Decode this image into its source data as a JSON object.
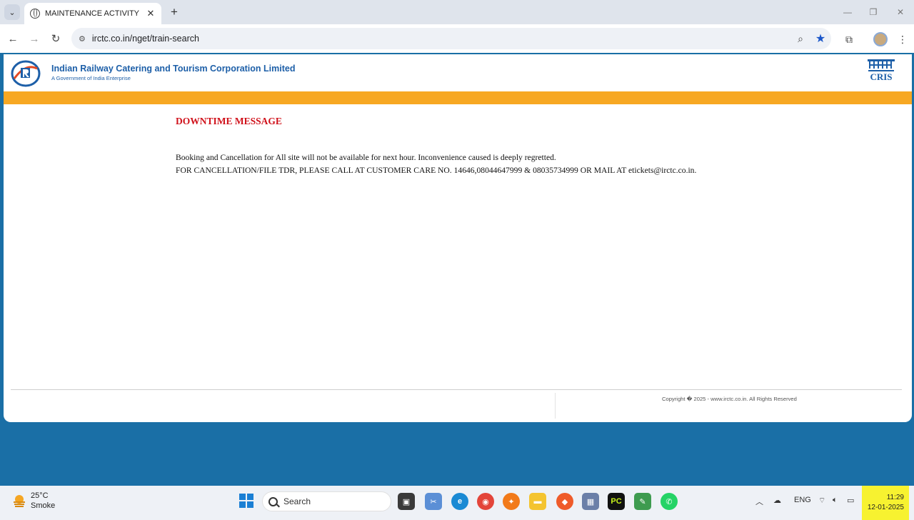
{
  "browser": {
    "tab_title": "MAINTENANCE ACTIVITY",
    "url": "irctc.co.in/nget/train-search"
  },
  "header": {
    "org_name": "Indian Railway Catering and Tourism Corporation Limited",
    "org_subtitle": "A Government of India Enterprise"
  },
  "content": {
    "title": "DOWNTIME MESSAGE",
    "lines": [
      "Booking and Cancellation for All site will not be available for next hour. Inconvenience caused is deeply regretted.",
      "FOR CANCELLATION/FILE TDR, PLEASE CALL AT CUSTOMER CARE NO. 14646,08044647999 & 08035734999 OR MAIL AT etickets@irctc.co.in."
    ]
  },
  "footer": {
    "copyright": "Copyright � 2025 - www.irctc.co.in. All Rights Reserved"
  },
  "taskbar": {
    "weather_temp": "25°C",
    "weather_condition": "Smoke",
    "search_label": "Search",
    "language": "ENG",
    "time": "11:29",
    "date": "12-01-2025"
  },
  "colors": {
    "accent_orange": "#f7a823",
    "title_red": "#d0121b",
    "brand_blue": "#1d5fa8",
    "background_blue": "#1a6fa6"
  }
}
